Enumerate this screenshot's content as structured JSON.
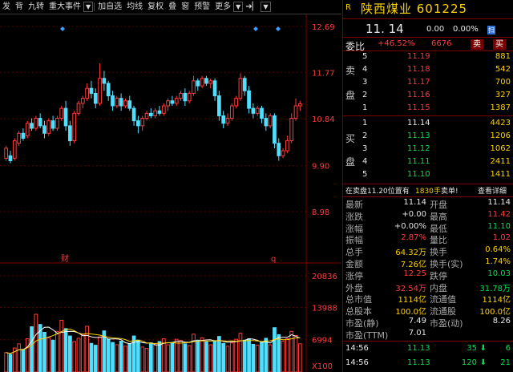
{
  "toolbar": {
    "items": [
      "发",
      "背",
      "九转",
      "重大事件",
      "加自选",
      "均线",
      "复权",
      "叠",
      "窗",
      "预警",
      "更多"
    ]
  },
  "chart": {
    "price_ticks": [
      "12.69",
      "11.77",
      "10.84",
      "9.90",
      "8.98"
    ],
    "volume_ticks": [
      "20836",
      "13988",
      "6994",
      "X100"
    ],
    "markers": {
      "cai": "财",
      "q": "q"
    }
  },
  "chart_data": {
    "type": "candlestick",
    "ylim": [
      8.98,
      12.69
    ],
    "candles": [
      {
        "o": 10.05,
        "c": 10.25,
        "h": 10.3,
        "l": 10.0
      },
      {
        "o": 10.1,
        "c": 10.0,
        "h": 10.2,
        "l": 9.95
      },
      {
        "o": 10.05,
        "c": 10.4,
        "h": 10.45,
        "l": 10.0
      },
      {
        "o": 10.35,
        "c": 10.55,
        "h": 10.6,
        "l": 10.3
      },
      {
        "o": 10.55,
        "c": 10.45,
        "h": 10.65,
        "l": 10.4
      },
      {
        "o": 10.5,
        "c": 10.75,
        "h": 10.8,
        "l": 10.45
      },
      {
        "o": 10.75,
        "c": 10.65,
        "h": 10.85,
        "l": 10.6
      },
      {
        "o": 10.65,
        "c": 10.85,
        "h": 10.9,
        "l": 10.6
      },
      {
        "o": 10.85,
        "c": 10.7,
        "h": 10.95,
        "l": 10.65
      },
      {
        "o": 10.7,
        "c": 10.55,
        "h": 10.8,
        "l": 10.45
      },
      {
        "o": 10.55,
        "c": 10.8,
        "h": 10.85,
        "l": 10.5
      },
      {
        "o": 10.8,
        "c": 10.65,
        "h": 10.9,
        "l": 10.6
      },
      {
        "o": 10.65,
        "c": 10.85,
        "h": 10.9,
        "l": 10.6
      },
      {
        "o": 10.85,
        "c": 11.05,
        "h": 11.1,
        "l": 10.8
      },
      {
        "o": 11.05,
        "c": 10.7,
        "h": 11.2,
        "l": 10.6
      },
      {
        "o": 10.7,
        "c": 10.4,
        "h": 10.8,
        "l": 10.3
      },
      {
        "o": 10.4,
        "c": 10.95,
        "h": 11.0,
        "l": 10.35
      },
      {
        "o": 10.95,
        "c": 11.15,
        "h": 11.2,
        "l": 10.9
      },
      {
        "o": 11.15,
        "c": 11.25,
        "h": 11.3,
        "l": 11.05
      },
      {
        "o": 11.25,
        "c": 11.45,
        "h": 11.55,
        "l": 11.2
      },
      {
        "o": 11.45,
        "c": 11.35,
        "h": 11.6,
        "l": 11.25
      },
      {
        "o": 11.35,
        "c": 11.15,
        "h": 11.45,
        "l": 11.05
      },
      {
        "o": 11.15,
        "c": 11.65,
        "h": 11.95,
        "l": 11.1
      },
      {
        "o": 11.65,
        "c": 11.55,
        "h": 11.8,
        "l": 11.4
      },
      {
        "o": 11.55,
        "c": 11.3,
        "h": 11.6,
        "l": 11.2
      },
      {
        "o": 11.3,
        "c": 11.1,
        "h": 11.4,
        "l": 11.0
      },
      {
        "o": 11.1,
        "c": 11.25,
        "h": 11.3,
        "l": 11.05
      },
      {
        "o": 11.25,
        "c": 11.1,
        "h": 11.35,
        "l": 11.0
      },
      {
        "o": 11.1,
        "c": 11.2,
        "h": 11.25,
        "l": 11.05
      },
      {
        "o": 11.2,
        "c": 11.05,
        "h": 11.3,
        "l": 11.0
      },
      {
        "o": 11.05,
        "c": 10.8,
        "h": 11.1,
        "l": 10.7
      },
      {
        "o": 10.8,
        "c": 10.7,
        "h": 10.9,
        "l": 10.55
      },
      {
        "o": 10.7,
        "c": 10.85,
        "h": 10.9,
        "l": 10.6
      },
      {
        "o": 10.85,
        "c": 10.95,
        "h": 11.0,
        "l": 10.8
      },
      {
        "o": 10.95,
        "c": 10.9,
        "h": 11.05,
        "l": 10.85
      },
      {
        "o": 10.9,
        "c": 11.0,
        "h": 11.05,
        "l": 10.85
      },
      {
        "o": 11.0,
        "c": 10.95,
        "h": 11.1,
        "l": 10.9
      },
      {
        "o": 10.95,
        "c": 11.1,
        "h": 11.15,
        "l": 10.9
      },
      {
        "o": 11.1,
        "c": 11.2,
        "h": 11.25,
        "l": 11.0
      },
      {
        "o": 11.2,
        "c": 11.15,
        "h": 11.3,
        "l": 11.1
      },
      {
        "o": 11.15,
        "c": 11.25,
        "h": 11.3,
        "l": 11.1
      },
      {
        "o": 11.25,
        "c": 11.35,
        "h": 11.4,
        "l": 11.2
      },
      {
        "o": 11.35,
        "c": 11.2,
        "h": 11.45,
        "l": 11.1
      },
      {
        "o": 11.2,
        "c": 11.35,
        "h": 11.4,
        "l": 11.15
      },
      {
        "o": 11.35,
        "c": 11.6,
        "h": 11.7,
        "l": 11.3
      },
      {
        "o": 11.6,
        "c": 11.5,
        "h": 11.65,
        "l": 11.4
      },
      {
        "o": 11.5,
        "c": 11.65,
        "h": 11.7,
        "l": 11.45
      },
      {
        "o": 11.65,
        "c": 11.55,
        "h": 11.7,
        "l": 11.5
      },
      {
        "o": 11.55,
        "c": 11.6,
        "h": 11.65,
        "l": 11.45
      },
      {
        "o": 11.6,
        "c": 11.3,
        "h": 11.65,
        "l": 11.2
      },
      {
        "o": 11.3,
        "c": 10.9,
        "h": 11.4,
        "l": 10.8
      },
      {
        "o": 10.9,
        "c": 10.75,
        "h": 11.0,
        "l": 10.65
      },
      {
        "o": 10.75,
        "c": 10.85,
        "h": 10.95,
        "l": 10.7
      },
      {
        "o": 10.85,
        "c": 11.1,
        "h": 11.15,
        "l": 10.8
      },
      {
        "o": 11.1,
        "c": 11.25,
        "h": 11.3,
        "l": 11.05
      },
      {
        "o": 11.25,
        "c": 11.65,
        "h": 11.75,
        "l": 11.2
      },
      {
        "o": 11.65,
        "c": 11.4,
        "h": 11.7,
        "l": 11.3
      },
      {
        "o": 11.4,
        "c": 11.05,
        "h": 11.5,
        "l": 10.95
      },
      {
        "o": 11.05,
        "c": 10.95,
        "h": 11.15,
        "l": 10.85
      },
      {
        "o": 10.95,
        "c": 11.05,
        "h": 11.1,
        "l": 10.9
      },
      {
        "o": 11.05,
        "c": 10.85,
        "h": 11.1,
        "l": 10.75
      },
      {
        "o": 10.85,
        "c": 10.7,
        "h": 10.95,
        "l": 10.6
      },
      {
        "o": 10.7,
        "c": 10.9,
        "h": 10.95,
        "l": 10.65
      },
      {
        "o": 10.9,
        "c": 10.35,
        "h": 10.95,
        "l": 10.25
      },
      {
        "o": 10.35,
        "c": 10.1,
        "h": 10.45,
        "l": 10.0
      },
      {
        "o": 10.1,
        "c": 10.2,
        "h": 10.25,
        "l": 10.05
      },
      {
        "o": 10.2,
        "c": 10.4,
        "h": 10.5,
        "l": 10.15
      },
      {
        "o": 10.4,
        "c": 10.85,
        "h": 10.95,
        "l": 10.35
      },
      {
        "o": 10.85,
        "c": 11.1,
        "h": 11.25,
        "l": 10.8
      },
      {
        "o": 11.1,
        "c": 11.14,
        "h": 11.2,
        "l": 11.0
      }
    ],
    "volumes": [
      4200,
      3800,
      5200,
      6100,
      4900,
      7200,
      9800,
      12500,
      10300,
      8600,
      7400,
      6900,
      8800,
      11200,
      9400,
      7800,
      6600,
      7300,
      8100,
      9900,
      6200,
      5800,
      7600,
      8900,
      7100,
      6400,
      5900,
      6700,
      5600,
      6100,
      7800,
      6900,
      5400,
      5100,
      6300,
      5800,
      6600,
      7200,
      5900,
      6400,
      7100,
      6800,
      6100,
      5700,
      8200,
      6900,
      7400,
      6500,
      5900,
      6800,
      7700,
      6200,
      5600,
      6300,
      7100,
      8400,
      6900,
      7200,
      6000,
      5800,
      6400,
      7300,
      5900,
      9600,
      8100,
      6700,
      7200,
      8800,
      7900,
      6100
    ],
    "candle_colors": {
      "up": "#ff3b3b",
      "down": "#4fe0ff"
    }
  },
  "stock": {
    "code_prefix": "R",
    "name": "陕西煤业 601225",
    "price": "11. 14",
    "change": "0.00",
    "change_pct": "0.00%",
    "tag": "扫"
  },
  "weibi": {
    "label1": "委比",
    "pct": "+46.52%",
    "diff": "6676",
    "sell": "卖",
    "buy": "买"
  },
  "sell_levels": [
    {
      "n": "5",
      "p": "11.19",
      "v": "881"
    },
    {
      "n": "4",
      "p": "11.18",
      "v": "542"
    },
    {
      "n": "3",
      "p": "11.17",
      "v": "700"
    },
    {
      "n": "2",
      "p": "11.16",
      "v": "327"
    },
    {
      "n": "1",
      "p": "11.15",
      "v": "1387"
    }
  ],
  "buy_levels": [
    {
      "n": "1",
      "p": "11.14",
      "v": "4423"
    },
    {
      "n": "2",
      "p": "11.13",
      "v": "1206"
    },
    {
      "n": "3",
      "p": "11.12",
      "v": "1062"
    },
    {
      "n": "4",
      "p": "11.11",
      "v": "2411"
    },
    {
      "n": "5",
      "p": "11.10",
      "v": "1411"
    }
  ],
  "side_labels": {
    "sell1": "卖",
    "sell2": "盘",
    "buy1": "买",
    "buy2": "盘"
  },
  "notice": {
    "text": "在卖盘11.20位置有",
    "qty": "1830手",
    "tail": "卖单!",
    "link": "查看详细"
  },
  "stats": [
    {
      "l": "最新",
      "v": "11.14",
      "l2": "开盘",
      "v2": "11.14",
      "c": "wht",
      "c2": "wht"
    },
    {
      "l": "涨跌",
      "v": "+0.00",
      "l2": "最高",
      "v2": "11.42",
      "c": "wht",
      "c2": "red"
    },
    {
      "l": "涨幅",
      "v": "+0.00%",
      "l2": "最低",
      "v2": "11.10",
      "c": "wht",
      "c2": "grn"
    },
    {
      "l": "振幅",
      "v": "2.87%",
      "l2": "量比",
      "v2": "1.02",
      "c": "red",
      "c2": "red"
    },
    {
      "l": "总手",
      "v": "64.32万",
      "l2": "换手",
      "v2": "0.64%",
      "c": "yel",
      "c2": "yel"
    },
    {
      "l": "金额",
      "v": "7.26亿",
      "l2": "换手(实)",
      "v2": "1.74%",
      "c": "yel",
      "c2": "yel"
    },
    {
      "l": "涨停",
      "v": "12.25",
      "l2": "跌停",
      "v2": "10.03",
      "c": "red",
      "c2": "grn"
    },
    {
      "l": "外盘",
      "v": "32.54万",
      "l2": "内盘",
      "v2": "31.78万",
      "c": "red",
      "c2": "grn"
    },
    {
      "l": "总市值",
      "v": "1114亿",
      "l2": "流通值",
      "v2": "1114亿",
      "c": "yel",
      "c2": "yel"
    },
    {
      "l": "总股本",
      "v": "100.0亿",
      "l2": "流通股",
      "v2": "100.0亿",
      "c": "yel",
      "c2": "yel"
    },
    {
      "l": "市盈(静)",
      "v": "7.49",
      "l2": "市盈(动)",
      "v2": "8.26",
      "c": "wht",
      "c2": "wht"
    },
    {
      "l": "市盈(TTM)",
      "v": "7.01",
      "l2": "",
      "v2": "",
      "c": "wht",
      "c2": "wht"
    }
  ],
  "ticks": [
    {
      "t": "14:56",
      "p": "11.13",
      "v": "35",
      "n": "6"
    },
    {
      "t": "14:56",
      "p": "11.13",
      "v": "120",
      "n": "21"
    }
  ],
  "colors": {
    "bg": "#000000",
    "up": "#ff3b3b",
    "down": "#00e14e",
    "accent": "#ffd200",
    "border": "#7a0000"
  }
}
